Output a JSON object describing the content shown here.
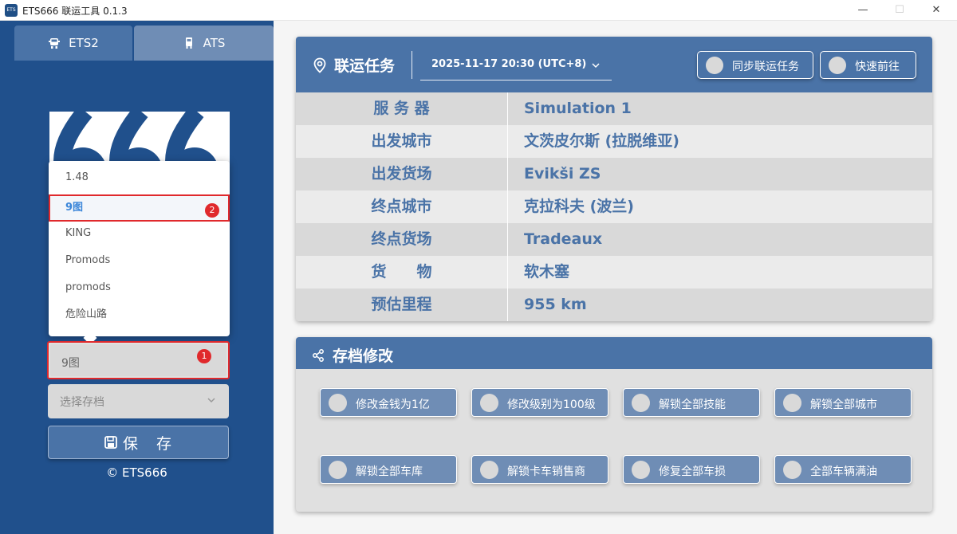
{
  "window": {
    "title": "ETS666 联运工具 0.1.3",
    "controls": {
      "minimize": "—",
      "maximize": "☐",
      "close": "✕"
    }
  },
  "sidebar": {
    "tabs": [
      {
        "label": "ETS2",
        "icon": "truck-icon",
        "active": true
      },
      {
        "label": "ATS",
        "icon": "truck-icon",
        "active": false
      }
    ],
    "logo_text": "666",
    "map_dropdown": {
      "options": [
        "1.48",
        "9图",
        "KING",
        "Promods",
        "promods",
        "危险山路"
      ],
      "highlighted": "9图",
      "highlight_badge": "2"
    },
    "map_select": {
      "value": "9图",
      "badge": "1"
    },
    "save_select": {
      "placeholder": "选择存档"
    },
    "save_button": "保　存",
    "copyright": "© ETS666"
  },
  "task_card": {
    "title": "联运任务",
    "date": "2025-11-17 20:30 (UTC+8)",
    "sync_button": "同步联运任务",
    "goto_button": "快速前往",
    "rows": [
      {
        "key": "服 务 器",
        "value": "Simulation 1"
      },
      {
        "key": "出发城市",
        "value": "文茨皮尔斯 (拉脱维亚)"
      },
      {
        "key": "出发货场",
        "value": "Evikši ZS"
      },
      {
        "key": "终点城市",
        "value": "克拉科夫 (波兰)"
      },
      {
        "key": "终点货场",
        "value": "Tradeaux"
      },
      {
        "key": "货　　物",
        "value": "软木塞"
      },
      {
        "key": "预估里程",
        "value": "955 km"
      }
    ]
  },
  "mod_card": {
    "title": "存档修改",
    "buttons": [
      "修改金钱为1亿",
      "修改级别为100级",
      "解锁全部技能",
      "解锁全部城市",
      "解锁全部车库",
      "解锁卡车销售商",
      "修复全部车损",
      "全部车辆满油"
    ]
  },
  "colors": {
    "sidebar_bg": "#20508c",
    "accent": "#4a73a7",
    "accent_light": "#6f8db5",
    "highlight": "#e0292c",
    "panel_bg": "#e0e0e0"
  }
}
